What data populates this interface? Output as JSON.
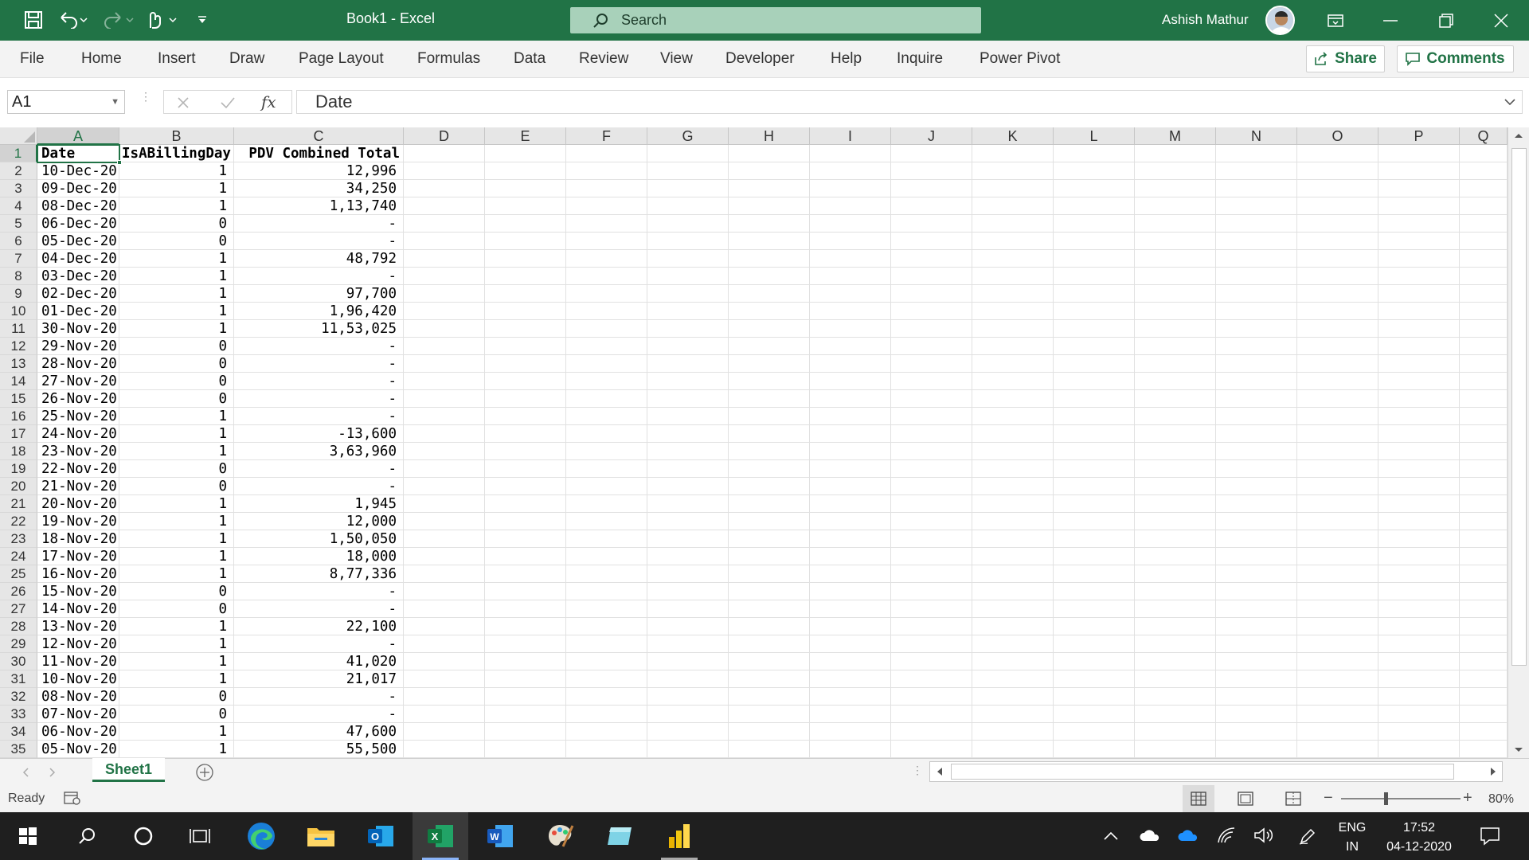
{
  "window": {
    "doc_title": "Book1  -  Excel",
    "search_placeholder": "Search",
    "user_name": "Ashish Mathur"
  },
  "menu": {
    "items": [
      "File",
      "Home",
      "Insert",
      "Draw",
      "Page Layout",
      "Formulas",
      "Data",
      "Review",
      "View",
      "Developer",
      "Help",
      "Inquire",
      "Power Pivot"
    ],
    "share_label": "Share",
    "comments_label": "Comments"
  },
  "formula_bar": {
    "name_box": "A1",
    "formula": "Date",
    "fx": "fx"
  },
  "grid": {
    "columns": [
      "A",
      "B",
      "C",
      "D",
      "E",
      "F",
      "G",
      "H",
      "I",
      "J",
      "K",
      "L",
      "M",
      "N",
      "O",
      "P",
      "Q"
    ],
    "header_row": [
      "Date",
      "IsABillingDay",
      "PDV Combined Total"
    ],
    "rows": [
      [
        "10-Dec-20",
        "1",
        "12,996"
      ],
      [
        "09-Dec-20",
        "1",
        "34,250"
      ],
      [
        "08-Dec-20",
        "1",
        "1,13,740"
      ],
      [
        "06-Dec-20",
        "0",
        "-"
      ],
      [
        "05-Dec-20",
        "0",
        "-"
      ],
      [
        "04-Dec-20",
        "1",
        "48,792"
      ],
      [
        "03-Dec-20",
        "1",
        "-"
      ],
      [
        "02-Dec-20",
        "1",
        "97,700"
      ],
      [
        "01-Dec-20",
        "1",
        "1,96,420"
      ],
      [
        "30-Nov-20",
        "1",
        "11,53,025"
      ],
      [
        "29-Nov-20",
        "0",
        "-"
      ],
      [
        "28-Nov-20",
        "0",
        "-"
      ],
      [
        "27-Nov-20",
        "0",
        "-"
      ],
      [
        "26-Nov-20",
        "0",
        "-"
      ],
      [
        "25-Nov-20",
        "1",
        "-"
      ],
      [
        "24-Nov-20",
        "1",
        "-13,600"
      ],
      [
        "23-Nov-20",
        "1",
        "3,63,960"
      ],
      [
        "22-Nov-20",
        "0",
        "-"
      ],
      [
        "21-Nov-20",
        "0",
        "-"
      ],
      [
        "20-Nov-20",
        "1",
        "1,945"
      ],
      [
        "19-Nov-20",
        "1",
        "12,000"
      ],
      [
        "18-Nov-20",
        "1",
        "1,50,050"
      ],
      [
        "17-Nov-20",
        "1",
        "18,000"
      ],
      [
        "16-Nov-20",
        "1",
        "8,77,336"
      ],
      [
        "15-Nov-20",
        "0",
        "-"
      ],
      [
        "14-Nov-20",
        "0",
        "-"
      ],
      [
        "13-Nov-20",
        "1",
        "22,100"
      ],
      [
        "12-Nov-20",
        "1",
        "-"
      ],
      [
        "11-Nov-20",
        "1",
        "41,020"
      ],
      [
        "10-Nov-20",
        "1",
        "21,017"
      ],
      [
        "08-Nov-20",
        "0",
        "-"
      ],
      [
        "07-Nov-20",
        "0",
        "-"
      ],
      [
        "06-Nov-20",
        "1",
        "47,600"
      ],
      [
        "05-Nov-20",
        "1",
        "55,500"
      ]
    ]
  },
  "sheets": {
    "active": "Sheet1"
  },
  "status": {
    "ready": "Ready",
    "zoom": "80%"
  },
  "taskbar": {
    "lang_top": "ENG",
    "lang_bottom": "IN",
    "time": "17:52",
    "date": "04-12-2020"
  },
  "colors": {
    "excel_green": "#217346",
    "taskbar": "#1f1f1f"
  }
}
